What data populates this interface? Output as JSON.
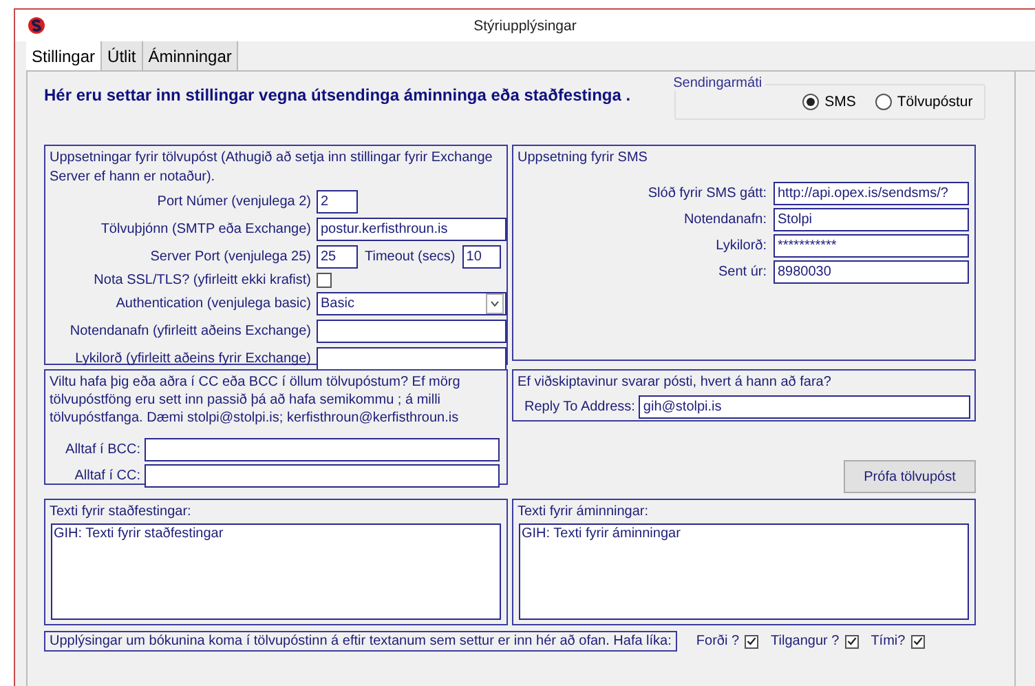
{
  "window": {
    "title": "Stýriupplýsingar"
  },
  "tabs": [
    {
      "label": "Stillingar",
      "selected": true
    },
    {
      "label": "Útlit",
      "selected": false
    },
    {
      "label": "Áminningar",
      "selected": false
    }
  ],
  "heading": "Hér eru settar inn stillingar vegna útsendinga áminninga eða staðfestinga .",
  "send_method": {
    "label": "Sendingarmáti",
    "options": [
      {
        "label": "SMS",
        "selected": true
      },
      {
        "label": "Tölvupóstur",
        "selected": false
      }
    ]
  },
  "email_setup": {
    "title": "Uppsetningar fyrir tölvupóst (Athugið að setja inn stillingar fyrir Exchange Server ef hann er notaður).",
    "fields": [
      {
        "kind": "short",
        "label": "Port Númer (venjulega 2)",
        "value": "2"
      },
      {
        "kind": "text",
        "label": "Tölvuþjónn (SMTP eða Exchange)",
        "value": "postur.kerfisthroun.is"
      },
      {
        "kind": "pair",
        "label": "Server Port (venjulega 25)",
        "value": "25",
        "label2": "Timeout (secs)",
        "value2": "10"
      },
      {
        "kind": "checkbox",
        "label": "Nota SSL/TLS? (yfirleitt ekki krafist)",
        "checked": false
      },
      {
        "kind": "select",
        "label": "Authentication (venjulega basic)",
        "value": "Basic"
      },
      {
        "kind": "text",
        "label": "Notendanafn (yfirleitt aðeins Exchange)"
      },
      {
        "kind": "text",
        "label": "Lykilorð (yfirleitt aðeins fyrir Exchange)"
      }
    ]
  },
  "sms_setup": {
    "title": "Uppsetning fyrir SMS",
    "fields": [
      {
        "label": "Slóð fyrir SMS gátt:",
        "value": "http://api.opex.is/sendsms/?"
      },
      {
        "label": "Notendanafn:",
        "value": "Stolpi"
      },
      {
        "label": "Lykilorð:",
        "value": "***********"
      },
      {
        "label": "Sent úr:",
        "value": "8980030"
      }
    ]
  },
  "cc": {
    "text": "Viltu hafa þig eða aðra í CC eða BCC í öllum tölvupóstum? Ef mörg tölvupóstföng eru sett inn passið þá að hafa semikommu ; á milli tölvupóstfanga. Dæmi stolpi@stolpi.is; kerfisthroun@kerfisthroun.is",
    "fields": [
      {
        "label": "Alltaf í BCC:"
      },
      {
        "label": "Alltaf í CC:"
      }
    ]
  },
  "reply": {
    "title": "Ef viðskiptavinur svarar pósti, hvert á hann að fara?",
    "label": "Reply To Address:",
    "value": "gih@stolpi.is"
  },
  "test_button": "Prófa tölvupóst",
  "message_texts": [
    {
      "title": "Texti fyrir staðfestingar:",
      "value": "GIH: Texti fyrir staðfestingar"
    },
    {
      "title": "Texti fyrir áminningar:",
      "value": "GIH: Texti fyrir áminningar"
    }
  ],
  "footer": {
    "text": "Upplýsingar um bókunina koma í tölvupóstinn á eftir textanum sem settur er inn hér að ofan. Hafa líka:",
    "checks": [
      {
        "label": "Forði ?",
        "checked": true
      },
      {
        "label": "Tilgangur ?",
        "checked": true
      },
      {
        "label": "Tími?",
        "checked": true
      }
    ]
  }
}
